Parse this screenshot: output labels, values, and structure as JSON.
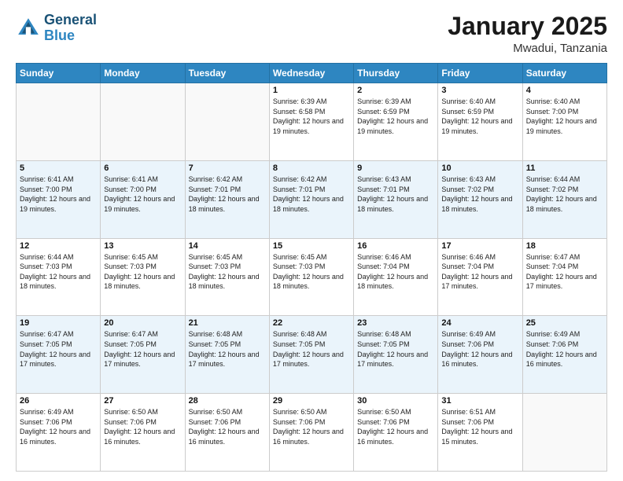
{
  "header": {
    "logo_line1": "General",
    "logo_line2": "Blue",
    "month": "January 2025",
    "location": "Mwadui, Tanzania"
  },
  "weekdays": [
    "Sunday",
    "Monday",
    "Tuesday",
    "Wednesday",
    "Thursday",
    "Friday",
    "Saturday"
  ],
  "weeks": [
    [
      {
        "day": "",
        "sunrise": "",
        "sunset": "",
        "daylight": ""
      },
      {
        "day": "",
        "sunrise": "",
        "sunset": "",
        "daylight": ""
      },
      {
        "day": "",
        "sunrise": "",
        "sunset": "",
        "daylight": ""
      },
      {
        "day": "1",
        "sunrise": "Sunrise: 6:39 AM",
        "sunset": "Sunset: 6:58 PM",
        "daylight": "Daylight: 12 hours and 19 minutes."
      },
      {
        "day": "2",
        "sunrise": "Sunrise: 6:39 AM",
        "sunset": "Sunset: 6:59 PM",
        "daylight": "Daylight: 12 hours and 19 minutes."
      },
      {
        "day": "3",
        "sunrise": "Sunrise: 6:40 AM",
        "sunset": "Sunset: 6:59 PM",
        "daylight": "Daylight: 12 hours and 19 minutes."
      },
      {
        "day": "4",
        "sunrise": "Sunrise: 6:40 AM",
        "sunset": "Sunset: 7:00 PM",
        "daylight": "Daylight: 12 hours and 19 minutes."
      }
    ],
    [
      {
        "day": "5",
        "sunrise": "Sunrise: 6:41 AM",
        "sunset": "Sunset: 7:00 PM",
        "daylight": "Daylight: 12 hours and 19 minutes."
      },
      {
        "day": "6",
        "sunrise": "Sunrise: 6:41 AM",
        "sunset": "Sunset: 7:00 PM",
        "daylight": "Daylight: 12 hours and 19 minutes."
      },
      {
        "day": "7",
        "sunrise": "Sunrise: 6:42 AM",
        "sunset": "Sunset: 7:01 PM",
        "daylight": "Daylight: 12 hours and 18 minutes."
      },
      {
        "day": "8",
        "sunrise": "Sunrise: 6:42 AM",
        "sunset": "Sunset: 7:01 PM",
        "daylight": "Daylight: 12 hours and 18 minutes."
      },
      {
        "day": "9",
        "sunrise": "Sunrise: 6:43 AM",
        "sunset": "Sunset: 7:01 PM",
        "daylight": "Daylight: 12 hours and 18 minutes."
      },
      {
        "day": "10",
        "sunrise": "Sunrise: 6:43 AM",
        "sunset": "Sunset: 7:02 PM",
        "daylight": "Daylight: 12 hours and 18 minutes."
      },
      {
        "day": "11",
        "sunrise": "Sunrise: 6:44 AM",
        "sunset": "Sunset: 7:02 PM",
        "daylight": "Daylight: 12 hours and 18 minutes."
      }
    ],
    [
      {
        "day": "12",
        "sunrise": "Sunrise: 6:44 AM",
        "sunset": "Sunset: 7:03 PM",
        "daylight": "Daylight: 12 hours and 18 minutes."
      },
      {
        "day": "13",
        "sunrise": "Sunrise: 6:45 AM",
        "sunset": "Sunset: 7:03 PM",
        "daylight": "Daylight: 12 hours and 18 minutes."
      },
      {
        "day": "14",
        "sunrise": "Sunrise: 6:45 AM",
        "sunset": "Sunset: 7:03 PM",
        "daylight": "Daylight: 12 hours and 18 minutes."
      },
      {
        "day": "15",
        "sunrise": "Sunrise: 6:45 AM",
        "sunset": "Sunset: 7:03 PM",
        "daylight": "Daylight: 12 hours and 18 minutes."
      },
      {
        "day": "16",
        "sunrise": "Sunrise: 6:46 AM",
        "sunset": "Sunset: 7:04 PM",
        "daylight": "Daylight: 12 hours and 18 minutes."
      },
      {
        "day": "17",
        "sunrise": "Sunrise: 6:46 AM",
        "sunset": "Sunset: 7:04 PM",
        "daylight": "Daylight: 12 hours and 17 minutes."
      },
      {
        "day": "18",
        "sunrise": "Sunrise: 6:47 AM",
        "sunset": "Sunset: 7:04 PM",
        "daylight": "Daylight: 12 hours and 17 minutes."
      }
    ],
    [
      {
        "day": "19",
        "sunrise": "Sunrise: 6:47 AM",
        "sunset": "Sunset: 7:05 PM",
        "daylight": "Daylight: 12 hours and 17 minutes."
      },
      {
        "day": "20",
        "sunrise": "Sunrise: 6:47 AM",
        "sunset": "Sunset: 7:05 PM",
        "daylight": "Daylight: 12 hours and 17 minutes."
      },
      {
        "day": "21",
        "sunrise": "Sunrise: 6:48 AM",
        "sunset": "Sunset: 7:05 PM",
        "daylight": "Daylight: 12 hours and 17 minutes."
      },
      {
        "day": "22",
        "sunrise": "Sunrise: 6:48 AM",
        "sunset": "Sunset: 7:05 PM",
        "daylight": "Daylight: 12 hours and 17 minutes."
      },
      {
        "day": "23",
        "sunrise": "Sunrise: 6:48 AM",
        "sunset": "Sunset: 7:05 PM",
        "daylight": "Daylight: 12 hours and 17 minutes."
      },
      {
        "day": "24",
        "sunrise": "Sunrise: 6:49 AM",
        "sunset": "Sunset: 7:06 PM",
        "daylight": "Daylight: 12 hours and 16 minutes."
      },
      {
        "day": "25",
        "sunrise": "Sunrise: 6:49 AM",
        "sunset": "Sunset: 7:06 PM",
        "daylight": "Daylight: 12 hours and 16 minutes."
      }
    ],
    [
      {
        "day": "26",
        "sunrise": "Sunrise: 6:49 AM",
        "sunset": "Sunset: 7:06 PM",
        "daylight": "Daylight: 12 hours and 16 minutes."
      },
      {
        "day": "27",
        "sunrise": "Sunrise: 6:50 AM",
        "sunset": "Sunset: 7:06 PM",
        "daylight": "Daylight: 12 hours and 16 minutes."
      },
      {
        "day": "28",
        "sunrise": "Sunrise: 6:50 AM",
        "sunset": "Sunset: 7:06 PM",
        "daylight": "Daylight: 12 hours and 16 minutes."
      },
      {
        "day": "29",
        "sunrise": "Sunrise: 6:50 AM",
        "sunset": "Sunset: 7:06 PM",
        "daylight": "Daylight: 12 hours and 16 minutes."
      },
      {
        "day": "30",
        "sunrise": "Sunrise: 6:50 AM",
        "sunset": "Sunset: 7:06 PM",
        "daylight": "Daylight: 12 hours and 16 minutes."
      },
      {
        "day": "31",
        "sunrise": "Sunrise: 6:51 AM",
        "sunset": "Sunset: 7:06 PM",
        "daylight": "Daylight: 12 hours and 15 minutes."
      },
      {
        "day": "",
        "sunrise": "",
        "sunset": "",
        "daylight": ""
      }
    ]
  ]
}
